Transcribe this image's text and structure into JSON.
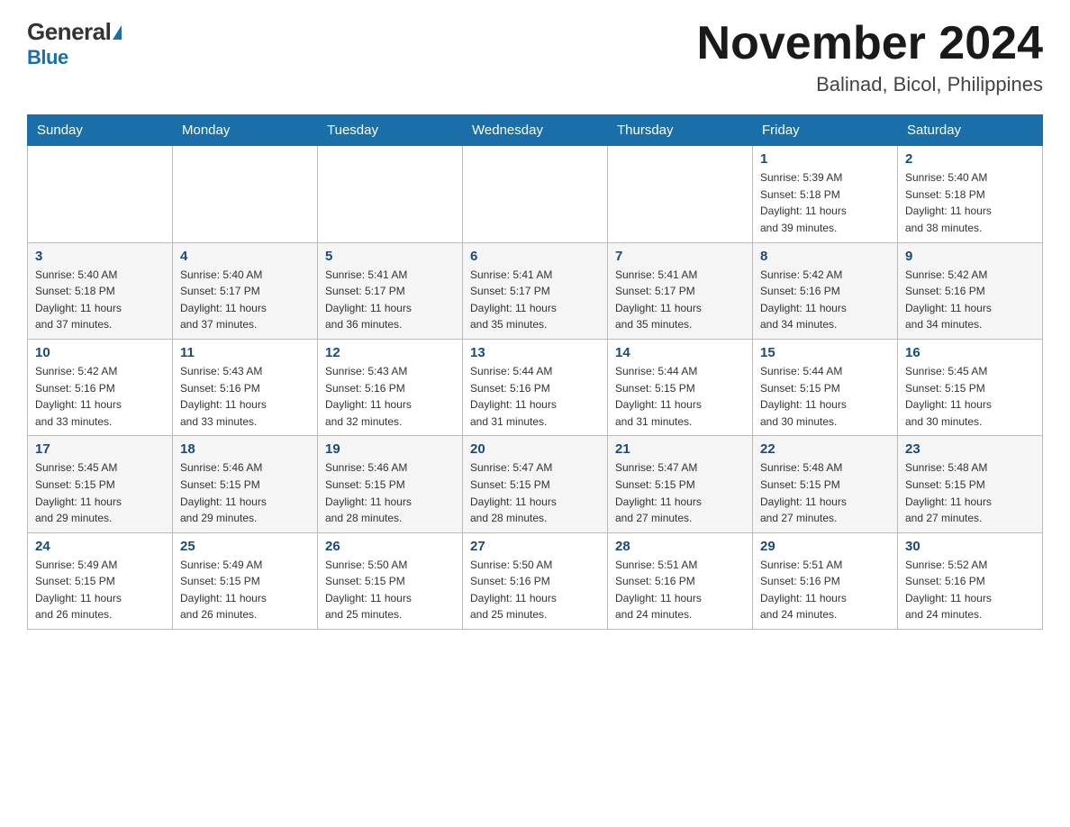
{
  "header": {
    "logo_general": "General",
    "logo_blue": "Blue",
    "month_title": "November 2024",
    "location": "Balinad, Bicol, Philippines"
  },
  "days_of_week": [
    "Sunday",
    "Monday",
    "Tuesday",
    "Wednesday",
    "Thursday",
    "Friday",
    "Saturday"
  ],
  "weeks": [
    {
      "days": [
        {
          "num": "",
          "info": ""
        },
        {
          "num": "",
          "info": ""
        },
        {
          "num": "",
          "info": ""
        },
        {
          "num": "",
          "info": ""
        },
        {
          "num": "",
          "info": ""
        },
        {
          "num": "1",
          "info": "Sunrise: 5:39 AM\nSunset: 5:18 PM\nDaylight: 11 hours\nand 39 minutes."
        },
        {
          "num": "2",
          "info": "Sunrise: 5:40 AM\nSunset: 5:18 PM\nDaylight: 11 hours\nand 38 minutes."
        }
      ]
    },
    {
      "days": [
        {
          "num": "3",
          "info": "Sunrise: 5:40 AM\nSunset: 5:18 PM\nDaylight: 11 hours\nand 37 minutes."
        },
        {
          "num": "4",
          "info": "Sunrise: 5:40 AM\nSunset: 5:17 PM\nDaylight: 11 hours\nand 37 minutes."
        },
        {
          "num": "5",
          "info": "Sunrise: 5:41 AM\nSunset: 5:17 PM\nDaylight: 11 hours\nand 36 minutes."
        },
        {
          "num": "6",
          "info": "Sunrise: 5:41 AM\nSunset: 5:17 PM\nDaylight: 11 hours\nand 35 minutes."
        },
        {
          "num": "7",
          "info": "Sunrise: 5:41 AM\nSunset: 5:17 PM\nDaylight: 11 hours\nand 35 minutes."
        },
        {
          "num": "8",
          "info": "Sunrise: 5:42 AM\nSunset: 5:16 PM\nDaylight: 11 hours\nand 34 minutes."
        },
        {
          "num": "9",
          "info": "Sunrise: 5:42 AM\nSunset: 5:16 PM\nDaylight: 11 hours\nand 34 minutes."
        }
      ]
    },
    {
      "days": [
        {
          "num": "10",
          "info": "Sunrise: 5:42 AM\nSunset: 5:16 PM\nDaylight: 11 hours\nand 33 minutes."
        },
        {
          "num": "11",
          "info": "Sunrise: 5:43 AM\nSunset: 5:16 PM\nDaylight: 11 hours\nand 33 minutes."
        },
        {
          "num": "12",
          "info": "Sunrise: 5:43 AM\nSunset: 5:16 PM\nDaylight: 11 hours\nand 32 minutes."
        },
        {
          "num": "13",
          "info": "Sunrise: 5:44 AM\nSunset: 5:16 PM\nDaylight: 11 hours\nand 31 minutes."
        },
        {
          "num": "14",
          "info": "Sunrise: 5:44 AM\nSunset: 5:15 PM\nDaylight: 11 hours\nand 31 minutes."
        },
        {
          "num": "15",
          "info": "Sunrise: 5:44 AM\nSunset: 5:15 PM\nDaylight: 11 hours\nand 30 minutes."
        },
        {
          "num": "16",
          "info": "Sunrise: 5:45 AM\nSunset: 5:15 PM\nDaylight: 11 hours\nand 30 minutes."
        }
      ]
    },
    {
      "days": [
        {
          "num": "17",
          "info": "Sunrise: 5:45 AM\nSunset: 5:15 PM\nDaylight: 11 hours\nand 29 minutes."
        },
        {
          "num": "18",
          "info": "Sunrise: 5:46 AM\nSunset: 5:15 PM\nDaylight: 11 hours\nand 29 minutes."
        },
        {
          "num": "19",
          "info": "Sunrise: 5:46 AM\nSunset: 5:15 PM\nDaylight: 11 hours\nand 28 minutes."
        },
        {
          "num": "20",
          "info": "Sunrise: 5:47 AM\nSunset: 5:15 PM\nDaylight: 11 hours\nand 28 minutes."
        },
        {
          "num": "21",
          "info": "Sunrise: 5:47 AM\nSunset: 5:15 PM\nDaylight: 11 hours\nand 27 minutes."
        },
        {
          "num": "22",
          "info": "Sunrise: 5:48 AM\nSunset: 5:15 PM\nDaylight: 11 hours\nand 27 minutes."
        },
        {
          "num": "23",
          "info": "Sunrise: 5:48 AM\nSunset: 5:15 PM\nDaylight: 11 hours\nand 27 minutes."
        }
      ]
    },
    {
      "days": [
        {
          "num": "24",
          "info": "Sunrise: 5:49 AM\nSunset: 5:15 PM\nDaylight: 11 hours\nand 26 minutes."
        },
        {
          "num": "25",
          "info": "Sunrise: 5:49 AM\nSunset: 5:15 PM\nDaylight: 11 hours\nand 26 minutes."
        },
        {
          "num": "26",
          "info": "Sunrise: 5:50 AM\nSunset: 5:15 PM\nDaylight: 11 hours\nand 25 minutes."
        },
        {
          "num": "27",
          "info": "Sunrise: 5:50 AM\nSunset: 5:16 PM\nDaylight: 11 hours\nand 25 minutes."
        },
        {
          "num": "28",
          "info": "Sunrise: 5:51 AM\nSunset: 5:16 PM\nDaylight: 11 hours\nand 24 minutes."
        },
        {
          "num": "29",
          "info": "Sunrise: 5:51 AM\nSunset: 5:16 PM\nDaylight: 11 hours\nand 24 minutes."
        },
        {
          "num": "30",
          "info": "Sunrise: 5:52 AM\nSunset: 5:16 PM\nDaylight: 11 hours\nand 24 minutes."
        }
      ]
    }
  ]
}
